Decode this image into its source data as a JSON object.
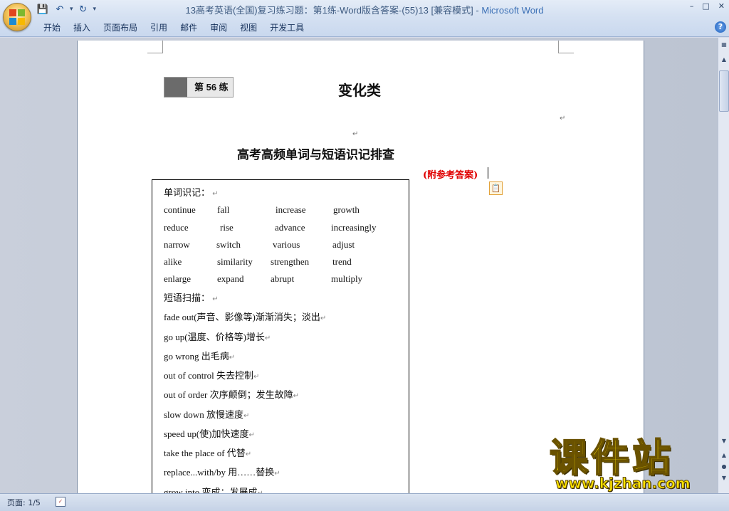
{
  "window": {
    "title_doc": "13高考英语(全国)复习练习题：第1练-Word版含答案-(55)13 [兼容模式]",
    "title_sep": " - ",
    "title_app": "Microsoft Word",
    "controls": {
      "minimize": "–",
      "restore": "□",
      "close": "✕"
    }
  },
  "quick_access": {
    "save": "💾",
    "undo": "↶",
    "redo": "↻",
    "customize": "▾"
  },
  "ribbon": {
    "tabs": [
      "开始",
      "插入",
      "页面布局",
      "引用",
      "邮件",
      "审阅",
      "视图",
      "开发工具"
    ],
    "help": "?"
  },
  "document": {
    "badge_label": "第 56 练",
    "main_title": "变化类",
    "heading": "高考高频单词与短语识记排查",
    "answer_note": "(附参考答案)",
    "box": {
      "words_header": "单词识记：",
      "word_rows": [
        [
          "continue",
          "fall",
          "increase",
          "growth"
        ],
        [
          "reduce",
          "rise",
          "advance",
          "increasingly"
        ],
        [
          "narrow",
          "switch",
          "various",
          "adjust"
        ],
        [
          "alike",
          "similarity",
          "strengthen",
          "trend"
        ],
        [
          "enlarge",
          "expand",
          "abrupt",
          "multiply"
        ]
      ],
      "phrases_header": "短语扫描：",
      "phrases": [
        "fade out(声音、影像等)渐渐消失；淡出",
        "go up(温度、价格等)增长",
        "go wrong 出毛病",
        "out of control  失去控制",
        "out of order 次序颠倒；发生故障",
        "slow down 放慢速度",
        "speed up(使)加快速度",
        "take the place of  代替",
        "replace...with/by 用……替换",
        "grow into 变成；发展成"
      ],
      "return_mark": "↵"
    }
  },
  "status": {
    "page": "页面: 1/5"
  },
  "watermark": {
    "text": "课件站",
    "url": "www.kjzhan.com"
  },
  "colors": {
    "accent": "#3a6fb5",
    "answer_red": "#e00000",
    "watermark_yellow": "#ffe400"
  }
}
